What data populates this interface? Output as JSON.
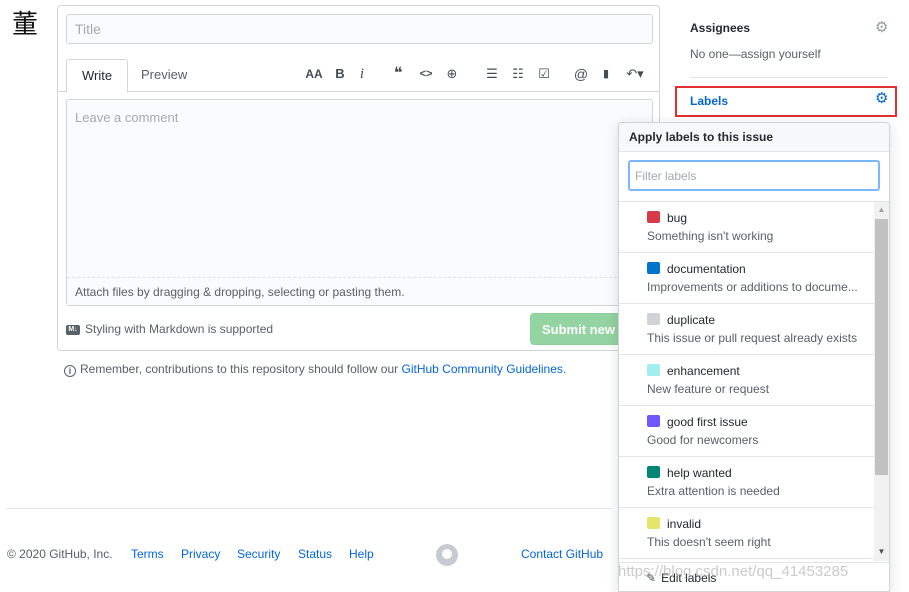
{
  "avatar_char": "董",
  "editor": {
    "title_placeholder": "Title",
    "tabs": {
      "write": "Write",
      "preview": "Preview"
    },
    "toolbar": {
      "heading": "AA",
      "bold": "B",
      "italic": "i",
      "quote": "❝",
      "code": "<>",
      "link": "⊕",
      "unordered_list": "☰",
      "ordered_list": "☷",
      "task_list": "☑",
      "mention": "@",
      "reference": "▮",
      "reply": "↶▾"
    },
    "comment_placeholder": "Leave a comment",
    "attach_text": "Attach files by dragging & dropping, selecting or pasting them.",
    "markdown_note": "Styling with Markdown is supported",
    "markdown_badge": "M↓",
    "submit_label": "Submit new is"
  },
  "remember": {
    "prefix": "Remember, contributions to this repository should follow our ",
    "link": "GitHub Community Guidelines",
    "suffix": "."
  },
  "sidebar": {
    "assignees_heading": "Assignees",
    "assignees_sub": "No one—assign yourself",
    "labels_heading": "Labels"
  },
  "labels_dropdown": {
    "header": "Apply labels to this issue",
    "filter_placeholder": "Filter labels",
    "items": [
      {
        "name": "bug",
        "desc": "Something isn't working",
        "color": "#d73a4a"
      },
      {
        "name": "documentation",
        "desc": "Improvements or additions to docume...",
        "color": "#0075ca"
      },
      {
        "name": "duplicate",
        "desc": "This issue or pull request already exists",
        "color": "#cfd3d7"
      },
      {
        "name": "enhancement",
        "desc": "New feature or request",
        "color": "#a2eeef"
      },
      {
        "name": "good first issue",
        "desc": "Good for newcomers",
        "color": "#7057ff"
      },
      {
        "name": "help wanted",
        "desc": "Extra attention is needed",
        "color": "#008672"
      },
      {
        "name": "invalid",
        "desc": "This doesn't seem right",
        "color": "#e4e669"
      }
    ],
    "footer": "Edit labels"
  },
  "footer": {
    "copyright": "© 2020 GitHub, Inc.",
    "links": {
      "terms": "Terms",
      "privacy": "Privacy",
      "security": "Security",
      "status": "Status",
      "help": "Help",
      "contact": "Contact GitHub"
    }
  },
  "watermark": "https://blog.csdn.net/qq_41453285"
}
